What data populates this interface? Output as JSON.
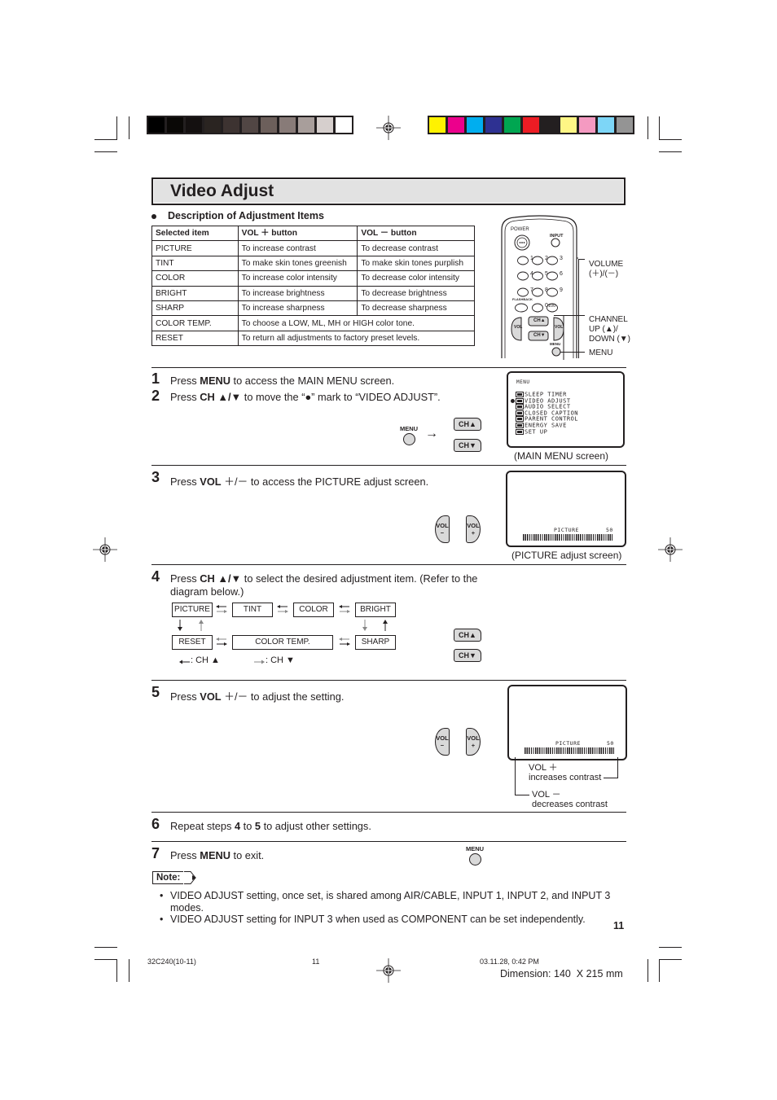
{
  "color_bars": {
    "grayscale": [
      "#000000",
      "#0a0806",
      "#141010",
      "#2a2421",
      "#3d3331",
      "#514644",
      "#6c5f5b",
      "#887b78",
      "#a89e9b",
      "#d6cfcd",
      "#ffffff"
    ],
    "colors": [
      "#fff200",
      "#ec008c",
      "#00aeef",
      "#2e3192",
      "#00a651",
      "#ed1c24",
      "#231f20",
      "#fff685",
      "#f49ac1",
      "#7dd6f7",
      "#949494"
    ]
  },
  "header": {
    "title": "Video Adjust"
  },
  "description": {
    "heading": "Description of Adjustment Items",
    "columns": [
      "Selected item",
      "VOL ＋ button",
      "VOL － button"
    ],
    "rows": [
      [
        "PICTURE",
        "To increase contrast",
        "To decrease contrast"
      ],
      [
        "TINT",
        "To make skin tones greenish",
        "To make skin tones purplish"
      ],
      [
        "COLOR",
        "To increase color intensity",
        "To decrease color intensity"
      ],
      [
        "BRIGHT",
        "To increase brightness",
        "To decrease brightness"
      ],
      [
        "SHARP",
        "To increase sharpness",
        "To decrease sharpness"
      ]
    ],
    "merged_rows": [
      [
        "COLOR TEMP.",
        "To choose a LOW, ML, MH or HIGH color tone."
      ],
      [
        "RESET",
        "To return all adjustments to factory preset levels."
      ]
    ]
  },
  "remote": {
    "power": "POWER",
    "input": "INPUT",
    "digits": [
      "1",
      "2",
      "3",
      "4",
      "5",
      "6",
      "7",
      "8",
      "9"
    ],
    "flashback": "FLASHBACK",
    "zero": "0",
    "hundred": "100",
    "ch_up": "CH▲",
    "ch_down": "CH▼",
    "vol": "VOL",
    "minus": "−",
    "plus": "+",
    "menu": "MENU",
    "labels": {
      "volume": "VOLUME",
      "volume_sub": "(＋)/(－)",
      "channel": "CHANNEL",
      "channel_up": "UP (▲)/",
      "channel_down": "DOWN (▼)",
      "menu": "MENU"
    }
  },
  "steps": [
    {
      "num": "1",
      "pre": "Press ",
      "bold": "MENU",
      "post": " to access the MAIN MENU screen."
    },
    {
      "num": "2",
      "pre": "Press ",
      "bold": "CH ▲/▼",
      "post": " to move the “●” mark to “VIDEO ADJUST”."
    },
    {
      "num": "3",
      "pre": "Press ",
      "bold": "VOL",
      "post": " ＋/－ to access the PICTURE adjust screen."
    },
    {
      "num": "4",
      "pre": "Press ",
      "bold": "CH ▲/▼",
      "post": " to select the desired adjustment item. (Refer to the",
      "line2": "diagram below.)"
    },
    {
      "num": "5",
      "pre": "Press ",
      "bold": "VOL",
      "post": " ＋/－ to adjust the setting."
    },
    {
      "num": "6",
      "pre": "Repeat steps ",
      "bold": "4",
      "mid": " to ",
      "bold2": "5",
      "post": " to adjust other settings."
    },
    {
      "num": "7",
      "pre": "Press ",
      "bold": "MENU",
      "post": " to exit."
    }
  ],
  "main_menu_screen": {
    "title": "MENU",
    "items": [
      "SLEEP TIMER",
      "VIDEO ADJUST",
      "AUDIO SELECT",
      "CLOSED CAPTION",
      "PARENT CONTROL",
      "ENERGY SAVE",
      "SET UP"
    ],
    "selected_index": 1,
    "caption": "(MAIN MENU screen)"
  },
  "picture_screen": {
    "label": "PICTURE",
    "value": "50",
    "caption": "(PICTURE adjust screen)"
  },
  "flow_diagram": {
    "top_row": [
      "PICTURE",
      "TINT",
      "COLOR",
      "BRIGHT"
    ],
    "bottom_row": [
      "RESET",
      "COLOR TEMP.",
      "SHARP"
    ],
    "legend_up": ": CH ▲",
    "legend_down": ": CH ▼"
  },
  "step5_annotations": {
    "vol_plus": "VOL ＋",
    "vol_plus_desc": "increases contrast",
    "vol_minus": "VOL －",
    "vol_minus_desc": "decreases contrast"
  },
  "note": {
    "label": "Note:",
    "bullets": [
      "VIDEO ADJUST setting, once set, is shared among AIR/CABLE, INPUT 1, INPUT 2, and INPUT 3",
      "VIDEO ADJUST setting for INPUT 3 when used as COMPONENT can be set independently."
    ],
    "bullet1_line2": "modes."
  },
  "page_number": "11",
  "footer": {
    "file": "32C240(10-11)",
    "page": "11",
    "datetime": "03.11.28, 0:42 PM",
    "dimension": "Dimension: 140  X 215 mm"
  }
}
